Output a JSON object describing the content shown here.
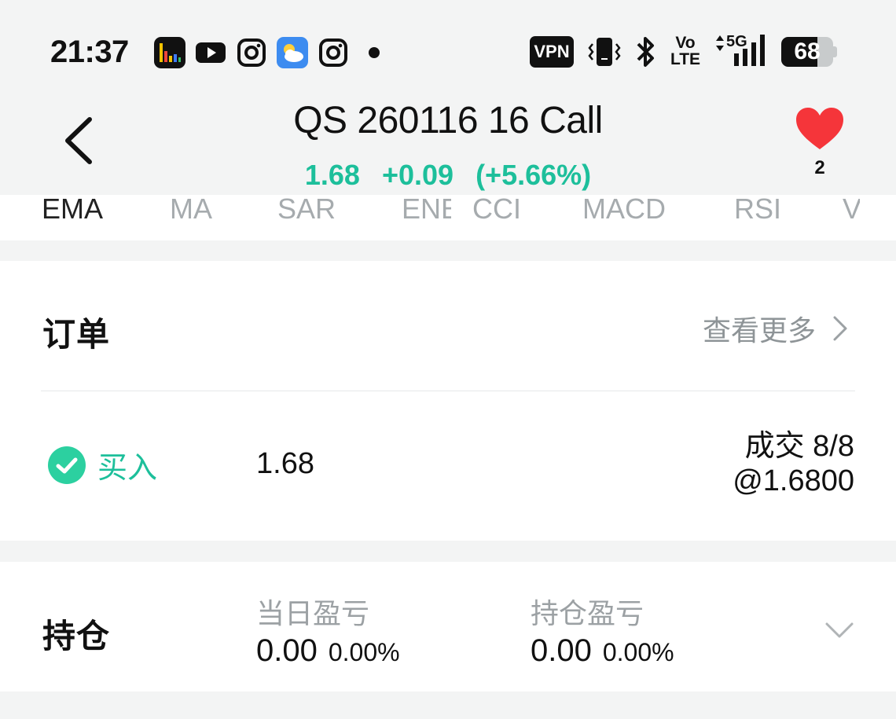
{
  "status_bar": {
    "time": "21:37",
    "apps": [
      "chart-app-icon",
      "youtube-icon",
      "instagram-icon",
      "weather-icon",
      "instagram-icon"
    ],
    "vpn_label": "VPN",
    "volte_top": "Vo",
    "volte_bottom": "LTE",
    "network": "5G",
    "battery": "68"
  },
  "header": {
    "title": "QS 260116 16 Call",
    "price": "1.68",
    "change": "+0.09",
    "change_pct": "(+5.66%)",
    "favorites_count": "2",
    "accent_color": "#1dbf9b"
  },
  "indicators": {
    "tabs": [
      "EMA",
      "MA",
      "SAR",
      "ENE",
      "CCI",
      "MACD",
      "RSI",
      "V"
    ],
    "active": "EMA"
  },
  "orders": {
    "title": "订单",
    "view_more": "查看更多",
    "rows": [
      {
        "side": "买入",
        "price": "1.68",
        "fill_status": "成交 8/8",
        "fill_price": "@1.6800"
      }
    ]
  },
  "positions": {
    "title": "持仓",
    "day_pnl_label": "当日盈亏",
    "day_pnl_value": "0.00",
    "day_pnl_pct": "0.00%",
    "hold_pnl_label": "持仓盈亏",
    "hold_pnl_value": "0.00",
    "hold_pnl_pct": "0.00%"
  }
}
